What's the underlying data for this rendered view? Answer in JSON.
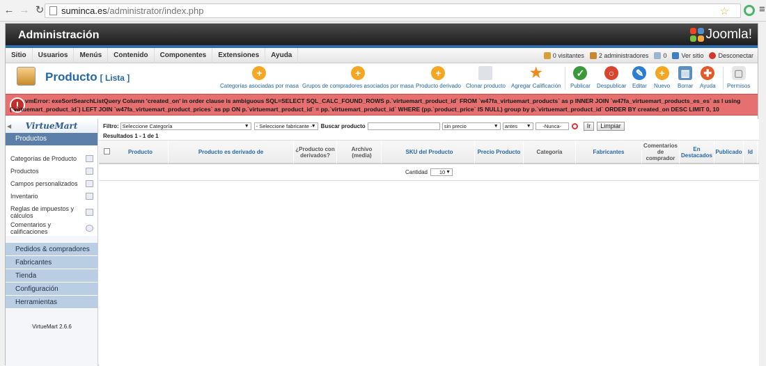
{
  "browser": {
    "url_host": "suminca.es",
    "url_path": "/administrator/index.php"
  },
  "header": {
    "title": "Administración",
    "logo_text": "Joomla!"
  },
  "topmenu": [
    "Sitio",
    "Usuarios",
    "Menús",
    "Contenido",
    "Componentes",
    "Extensiones",
    "Ayuda"
  ],
  "status": {
    "visitors": "0 visitantes",
    "admins": "2 administradores",
    "messages": "0",
    "view_site": "Ver sitio",
    "logout": "Desconectar"
  },
  "page": {
    "title": "Producto",
    "subtitle": "[ Lista ]"
  },
  "toolbar": {
    "cat_mass": "Categorías asociadas por masa",
    "groups_mass": "Grupos de compradores asociados por masa",
    "derived": "Producto derivado",
    "clone": "Clonar producto",
    "rate": "Agregar Calificación",
    "publish": "Publicar",
    "unpublish": "Despublicar",
    "edit": "Editar",
    "new": "Nuevo",
    "delete": "Borrar",
    "help": "Ayuda",
    "perms": "Permisos"
  },
  "error": {
    "message": "vmError: exeSortSearchListQuery Column 'created_on' in order clause is ambiguous SQL=SELECT SQL_CALC_FOUND_ROWS p.`virtuemart_product_id` FROM `w47fa_virtuemart_products` as p INNER JOIN `w47fa_virtuemart_products_es_es` as l using (`virtuemart_product_id`) LEFT JOIN `w47fa_virtuemart_product_prices` as pp ON p.`virtuemart_product_id` = pp.`virtuemart_product_id` WHERE (pp.`product_price` IS NULL) group by p.`virtuemart_product_id` ORDER BY created_on DESC LIMIT 0, 10"
  },
  "sidebar": {
    "logo": "VirtueMart",
    "active": "Productos",
    "items": [
      "Categorías de Producto",
      "Productos",
      "Campos personalizados",
      "Inventario",
      "Reglas de impuestos y cálculos",
      "Comentarios y calificaciones"
    ],
    "categories": [
      "Pedidos & compradores",
      "Fabricantes",
      "Tienda",
      "Configuración",
      "Herramientas"
    ],
    "version": "VirtueMart 2.6.6"
  },
  "filter": {
    "label": "Filtro:",
    "category": "Seleccione Categoría",
    "manufacturer": "- Seleccione fabricante -",
    "search_label": "Buscar producto",
    "search_value": "",
    "price": "sin precio",
    "date_mode": "antes",
    "date": "-Nunca-",
    "go": "Ir",
    "clear": "Limpiar"
  },
  "results": "Resultados 1 - 1 de 1",
  "columns": [
    "Producto",
    "Producto es derivado de",
    "¿Producto con derivados?",
    "Archivo (media)",
    "SKU del Producto",
    "Precio Producto",
    "Categoría",
    "Fabricantes",
    "Comentarios de comprador",
    "En Destacados",
    "Publicado",
    "Id"
  ],
  "pager": {
    "label": "Cantidad",
    "value": "10"
  }
}
